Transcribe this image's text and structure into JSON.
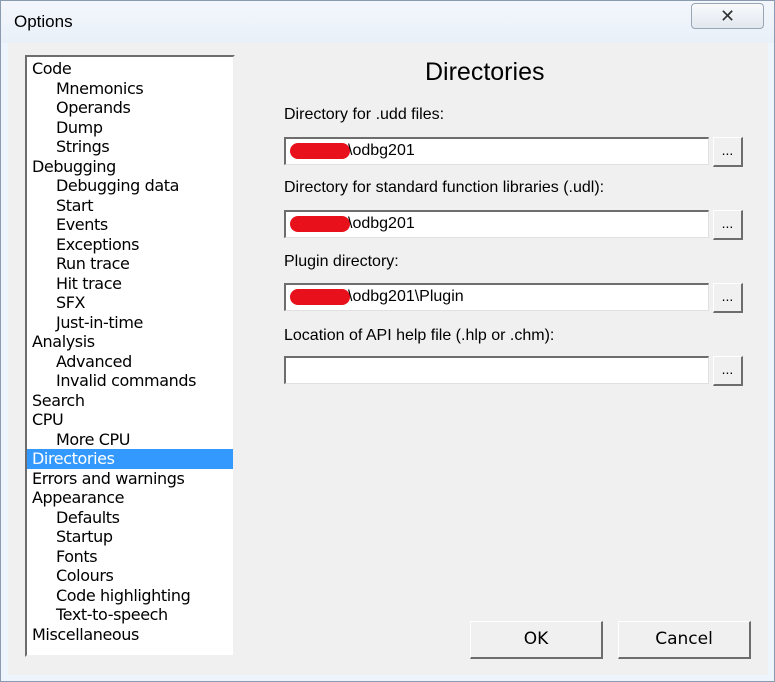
{
  "window": {
    "title": "Options",
    "close_glyph": "✕"
  },
  "tree": {
    "items": [
      {
        "label": "Code",
        "level": 0
      },
      {
        "label": "Mnemonics",
        "level": 1
      },
      {
        "label": "Operands",
        "level": 1
      },
      {
        "label": "Dump",
        "level": 1
      },
      {
        "label": "Strings",
        "level": 1
      },
      {
        "label": "Debugging",
        "level": 0
      },
      {
        "label": "Debugging data",
        "level": 1
      },
      {
        "label": "Start",
        "level": 1
      },
      {
        "label": "Events",
        "level": 1
      },
      {
        "label": "Exceptions",
        "level": 1
      },
      {
        "label": "Run trace",
        "level": 1
      },
      {
        "label": "Hit trace",
        "level": 1
      },
      {
        "label": "SFX",
        "level": 1
      },
      {
        "label": "Just-in-time",
        "level": 1
      },
      {
        "label": "Analysis",
        "level": 0
      },
      {
        "label": "Advanced",
        "level": 1
      },
      {
        "label": "Invalid commands",
        "level": 1
      },
      {
        "label": "Search",
        "level": 0
      },
      {
        "label": "CPU",
        "level": 0
      },
      {
        "label": "More CPU",
        "level": 1
      },
      {
        "label": "Directories",
        "level": 0,
        "selected": true
      },
      {
        "label": "Errors and warnings",
        "level": 0
      },
      {
        "label": "Appearance",
        "level": 0
      },
      {
        "label": "Defaults",
        "level": 1
      },
      {
        "label": "Startup",
        "level": 1
      },
      {
        "label": "Fonts",
        "level": 1
      },
      {
        "label": "Colours",
        "level": 1
      },
      {
        "label": "Code highlighting",
        "level": 1
      },
      {
        "label": "Text-to-speech",
        "level": 1
      },
      {
        "label": "Miscellaneous",
        "level": 0
      }
    ]
  },
  "panel": {
    "heading": "Directories",
    "fields": [
      {
        "label": "Directory for .udd files:",
        "value": "\\odbg201",
        "redacted_prefix": true
      },
      {
        "label": "Directory for standard function libraries (.udl):",
        "value": "\\odbg201",
        "redacted_prefix": true
      },
      {
        "label": "Plugin directory:",
        "value": "\\odbg201\\Plugin",
        "redacted_prefix": true
      },
      {
        "label": "Location of API help file (.hlp or .chm):",
        "value": "",
        "redacted_prefix": false
      }
    ],
    "browse_label": "..."
  },
  "buttons": {
    "ok": "OK",
    "cancel": "Cancel"
  },
  "colors": {
    "selection": "#3399ff",
    "redaction": "#e8101a",
    "dialog_bg": "#f0f0f0"
  }
}
